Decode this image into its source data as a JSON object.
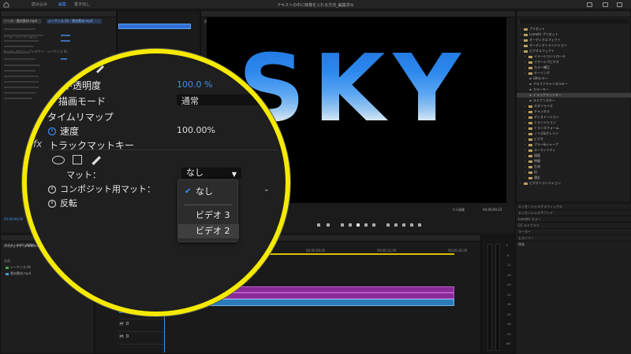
{
  "app": {
    "workspace_tabs": [
      "読み込み",
      "編集",
      "書き出し"
    ],
    "active_tab": "編集",
    "document_title": "テキストの中に映像を入れる方法_編集済み"
  },
  "effect_controls": {
    "tabs": [
      "エフェクトコントロール",
      "Lumetri スコープ",
      "ソース：(クリップなし)",
      "オーディオクリップミキサー：シーケンス 01"
    ],
    "source_label": "ソース・素材素材.mp4",
    "clip_label": "シーケンス 01・素材素材.mp4",
    "timecode": "00;00;00;00"
  },
  "program_monitor": {
    "title": "プログラム: シーケンス 01",
    "video_text": "SKY",
    "timecode_left": "00;00;00;00",
    "fit": "フル画質",
    "timecode_right": "00;00;09;23"
  },
  "effects_panel": {
    "title": "エフェクト",
    "items": [
      {
        "label": "プリセット",
        "level": 0
      },
      {
        "label": "Lumetri プリセット",
        "level": 0
      },
      {
        "label": "オーディオエフェクト",
        "level": 0
      },
      {
        "label": "オーディオトランジション",
        "level": 0
      },
      {
        "label": "ビデオエフェクト",
        "level": 0
      },
      {
        "label": "イメージコントロール",
        "level": 1
      },
      {
        "label": "イマーシブビデオ",
        "level": 1
      },
      {
        "label": "カラー補正",
        "level": 1
      },
      {
        "label": "キーイング",
        "level": 1
      },
      {
        "label": "Ultra キー",
        "level": 2
      },
      {
        "label": "アルファチャンネルキー",
        "level": 2
      },
      {
        "label": "カラーキー",
        "level": 2
      },
      {
        "label": "トラックマットキー",
        "level": 2,
        "selected": true
      },
      {
        "label": "ルミナンスキー",
        "level": 2
      },
      {
        "label": "スタイライズ",
        "level": 1
      },
      {
        "label": "チャンネル",
        "level": 1
      },
      {
        "label": "ディストーション",
        "level": 1
      },
      {
        "label": "トランジション",
        "level": 1
      },
      {
        "label": "トランスフォーム",
        "level": 1
      },
      {
        "label": "ノイズ&グレイン",
        "level": 1
      },
      {
        "label": "ビデオ",
        "level": 1
      },
      {
        "label": "ブラー&シャープ",
        "level": 1
      },
      {
        "label": "ユーティリティ",
        "level": 1
      },
      {
        "label": "描画",
        "level": 1
      },
      {
        "label": "時間",
        "level": 1
      },
      {
        "label": "生成",
        "level": 1
      },
      {
        "label": "旧",
        "level": 1
      },
      {
        "label": "遠近",
        "level": 1
      },
      {
        "label": "ビデオトランジション",
        "level": 0
      }
    ],
    "side_panels": [
      "エッセンシャルグラフィックス",
      "エッセンシャルサウンド",
      "Lumetri カラー",
      "CC ライブラリ",
      "マーカー",
      "ヒストリー",
      "情報"
    ]
  },
  "project": {
    "title": "プロジェクト: テキストの中に映像",
    "file": "テキストの中に映像を入れる.prproj",
    "column": "名前",
    "items": [
      {
        "name": "シーケンス 01",
        "color": "#3fae3f"
      },
      {
        "name": "素材素材.mp4",
        "color": "#3f9bd6"
      }
    ]
  },
  "timeline": {
    "title": "シーケンス 01",
    "timecode": "00;00;00;00",
    "ruler_ticks": [
      "00;00",
      "00;00;04;00",
      "00;00;08;00",
      "00;00;12;00",
      "00;00;16;00"
    ],
    "tracks": [
      "V3",
      "V2",
      "V1",
      "A1",
      "A2",
      "A3"
    ],
    "v3_label": "グラフィック",
    "v1_label": "素材素材.mp4"
  },
  "meter": {
    "scale": [
      "0",
      "-6",
      "-12",
      "-18",
      "-24",
      "-30",
      "-36",
      "-42",
      "-48",
      "-54",
      "dB"
    ]
  },
  "magnifier": {
    "opacity_label": "不透明度",
    "opacity_value": "100.0 %",
    "blend_label": "描画モード",
    "blend_value": "通常",
    "time_remap_label": "タイムリマップ",
    "speed_label": "速度",
    "speed_value": "100.00%",
    "fx_prefix": "fx",
    "track_matte_label": "トラックマットキー",
    "matte_label": "マット：",
    "matte_value": "なし",
    "composite_label": "コンポジット用マット：",
    "reverse_label": "反転"
  },
  "dropdown": {
    "items": [
      {
        "label": "なし",
        "checked": true
      },
      {
        "label": "ビデオ 3",
        "checked": false
      },
      {
        "label": "ビデオ 2",
        "checked": false,
        "highlighted": true
      }
    ]
  }
}
